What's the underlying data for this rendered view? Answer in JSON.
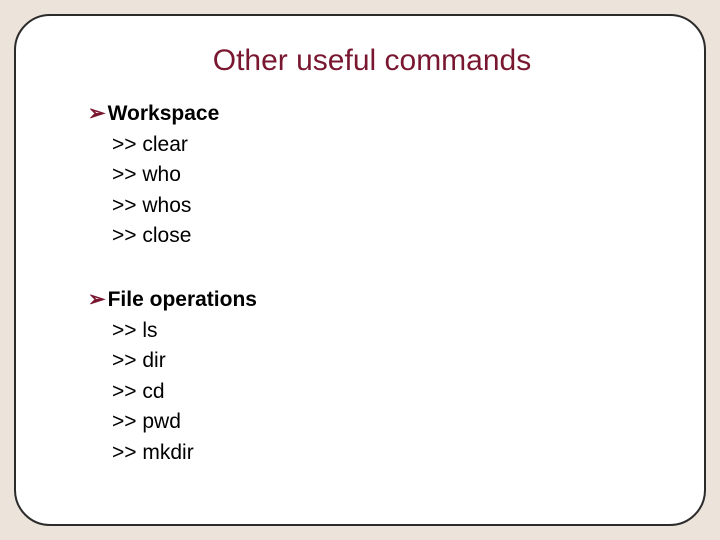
{
  "title": "Other useful commands",
  "arrow_glyph": "➢",
  "prompt": ">>",
  "sections": [
    {
      "header": "Workspace",
      "commands": [
        "clear",
        "who",
        "whos",
        "close"
      ]
    },
    {
      "header": "File operations",
      "commands": [
        "ls",
        "dir",
        "cd",
        "pwd",
        "mkdir"
      ]
    }
  ]
}
